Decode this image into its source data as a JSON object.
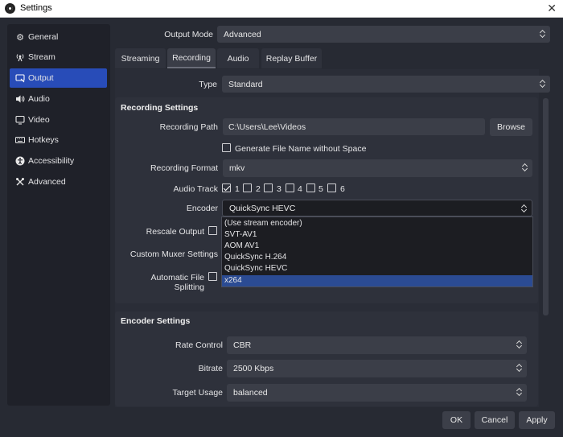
{
  "window": {
    "title": "Settings",
    "close_glyph": "✕"
  },
  "sidebar": {
    "items": [
      {
        "label": "General",
        "icon": "gear-icon",
        "glyph": "⚙"
      },
      {
        "label": "Stream",
        "icon": "antenna-icon",
        "glyph": "📡"
      },
      {
        "label": "Output",
        "icon": "output-icon",
        "glyph": "▭",
        "active": true
      },
      {
        "label": "Audio",
        "icon": "speaker-icon",
        "glyph": "🔊"
      },
      {
        "label": "Video",
        "icon": "monitor-icon",
        "glyph": "▭"
      },
      {
        "label": "Hotkeys",
        "icon": "keyboard-icon",
        "glyph": "⌨"
      },
      {
        "label": "Accessibility",
        "icon": "accessibility-icon",
        "glyph": "♿"
      },
      {
        "label": "Advanced",
        "icon": "wrench-icon",
        "glyph": "✕"
      }
    ]
  },
  "output_mode": {
    "label": "Output Mode",
    "value": "Advanced"
  },
  "tabs": [
    {
      "label": "Streaming"
    },
    {
      "label": "Recording",
      "active": true
    },
    {
      "label": "Audio"
    },
    {
      "label": "Replay Buffer"
    }
  ],
  "type": {
    "label": "Type",
    "value": "Standard"
  },
  "recording_settings": {
    "title": "Recording Settings",
    "path_label": "Recording Path",
    "path_value": "C:\\Users\\Lee\\Videos",
    "browse_label": "Browse",
    "gen_filename_label": "Generate File Name without Space",
    "format_label": "Recording Format",
    "format_value": "mkv",
    "audio_track_label": "Audio Track",
    "tracks": [
      "1",
      "2",
      "3",
      "4",
      "5",
      "6"
    ],
    "encoder_label": "Encoder",
    "encoder_value": "QuickSync HEVC",
    "rescale_label": "Rescale Output",
    "muxer_label": "Custom Muxer Settings",
    "splitting_label": "Automatic File Splitting",
    "encoder_options": [
      "(Use stream encoder)",
      "SVT-AV1",
      "AOM AV1",
      "QuickSync H.264",
      "QuickSync HEVC",
      "x264"
    ],
    "encoder_highlighted": "x264"
  },
  "encoder_settings": {
    "title": "Encoder Settings",
    "rate_control_label": "Rate Control",
    "rate_control_value": "CBR",
    "bitrate_label": "Bitrate",
    "bitrate_value": "2500 Kbps",
    "target_usage_label": "Target Usage",
    "target_usage_value": "balanced"
  },
  "footer": {
    "ok": "OK",
    "cancel": "Cancel",
    "apply": "Apply"
  },
  "colors": {
    "accent": "#284cb8",
    "background": "#272a33",
    "selection": "#2b4b93"
  }
}
